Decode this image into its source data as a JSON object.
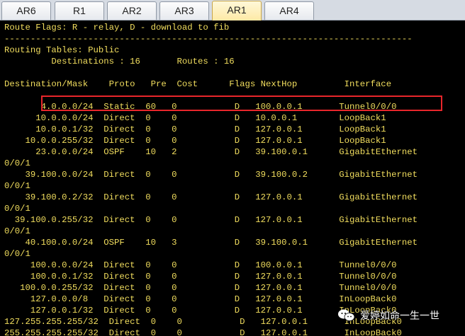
{
  "tabs": [
    {
      "label": "AR6",
      "active": false
    },
    {
      "label": "R1",
      "active": false
    },
    {
      "label": "AR2",
      "active": false
    },
    {
      "label": "AR3",
      "active": false
    },
    {
      "label": "AR1",
      "active": true
    },
    {
      "label": "AR4",
      "active": false
    }
  ],
  "terminal": {
    "lines": [
      "Route Flags: R - relay, D - download to fib",
      "------------------------------------------------------------------------------",
      "Routing Tables: Public",
      "         Destinations : 16       Routes : 16",
      "",
      "Destination/Mask    Proto   Pre  Cost      Flags NextHop         Interface",
      "",
      "       4.0.0.0/24  Static  60   0           D   100.0.0.1       Tunnel0/0/0",
      "      10.0.0.0/24  Direct  0    0           D   10.0.0.1        LoopBack1",
      "      10.0.0.1/32  Direct  0    0           D   127.0.0.1       LoopBack1",
      "    10.0.0.255/32  Direct  0    0           D   127.0.0.1       LoopBack1",
      "      23.0.0.0/24  OSPF    10   2           D   39.100.0.1      GigabitEthernet",
      "0/0/1",
      "    39.100.0.0/24  Direct  0    0           D   39.100.0.2      GigabitEthernet",
      "0/0/1",
      "    39.100.0.2/32  Direct  0    0           D   127.0.0.1       GigabitEthernet",
      "0/0/1",
      "  39.100.0.255/32  Direct  0    0           D   127.0.0.1       GigabitEthernet",
      "0/0/1",
      "    40.100.0.0/24  OSPF    10   3           D   39.100.0.1      GigabitEthernet",
      "0/0/1",
      "     100.0.0.0/24  Direct  0    0           D   100.0.0.1       Tunnel0/0/0",
      "     100.0.0.1/32  Direct  0    0           D   127.0.0.1       Tunnel0/0/0",
      "   100.0.0.255/32  Direct  0    0           D   127.0.0.1       Tunnel0/0/0",
      "     127.0.0.0/8   Direct  0    0           D   127.0.0.1       InLoopBack0",
      "     127.0.0.1/32  Direct  0    0           D   127.0.0.1       InLoopBack0",
      "127.255.255.255/32  Direct  0    0           D   127.0.0.1       InLoopBack0",
      "255.255.255.255/32  Direct  0    0           D   127.0.0.1       InLoopBack0"
    ]
  },
  "colors": {
    "terminal_text": "#f2de5e",
    "terminal_bg": "#000000",
    "highlight_border": "#e8262b"
  },
  "watermark": {
    "text": "爱婷如命一生一世"
  }
}
